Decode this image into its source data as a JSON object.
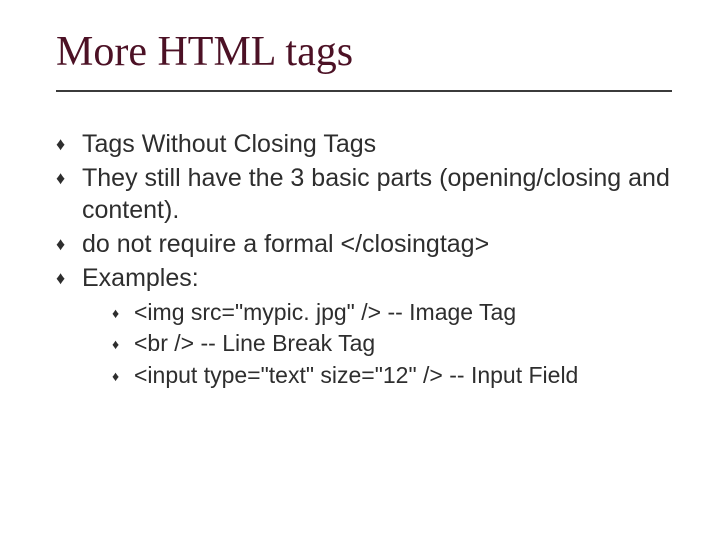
{
  "slide": {
    "title": "More HTML tags",
    "bullets": [
      {
        "text": "Tags Without Closing Tags"
      },
      {
        "text": "They still have the 3 basic parts (opening/closing and content)."
      },
      {
        "text": "do not require a formal </closingtag>"
      },
      {
        "text": "Examples:"
      }
    ],
    "sub_bullets": [
      {
        "text": "<img src=\"mypic. jpg\" /> -- Image Tag"
      },
      {
        "text": "<br /> -- Line Break Tag"
      },
      {
        "text": "<input type=\"text\" size=\"12\" /> -- Input Field"
      }
    ]
  }
}
